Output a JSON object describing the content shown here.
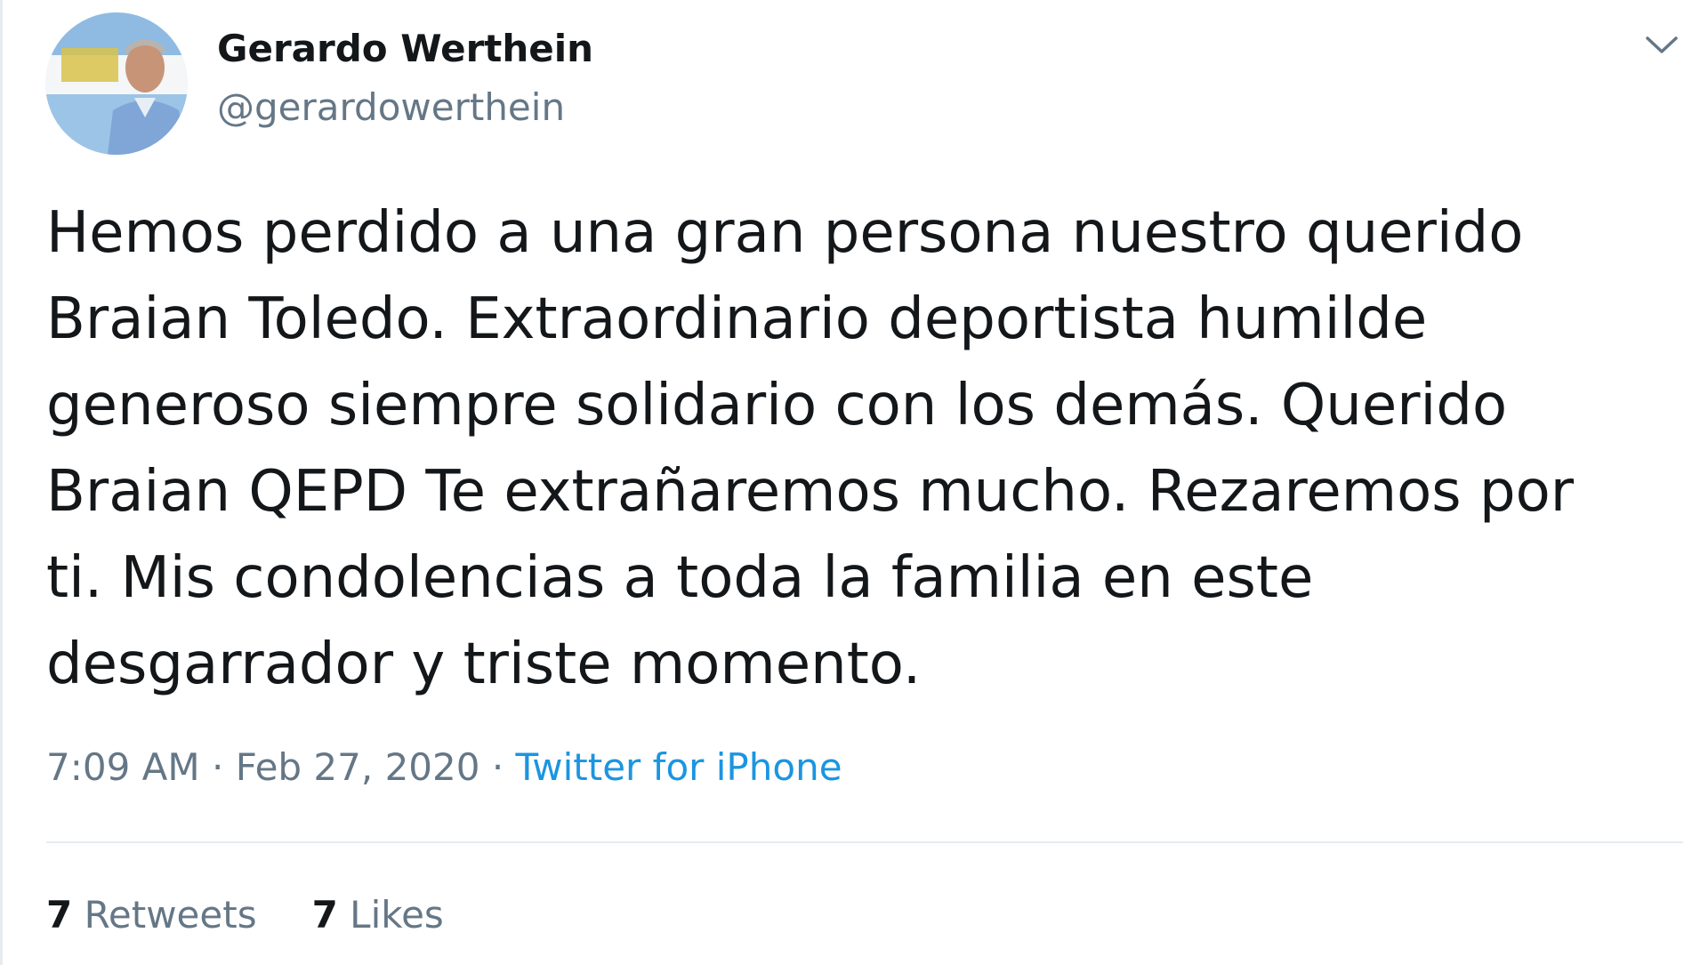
{
  "colors": {
    "text_primary": "#14171a",
    "text_secondary": "#657786",
    "link": "#1b95e0",
    "divider": "#e6ecf0"
  },
  "author": {
    "display_name": "Gerardo Werthein",
    "username": "@gerardowerthein",
    "avatar": "profile-photo"
  },
  "menu": {
    "icon": "chevron-down-icon"
  },
  "tweet": {
    "lines": [
      "Hemos perdido a una gran persona nuestro querido",
      "Braian Toledo. Extraordinario deportista humilde",
      "generoso siempre solidario con los demás.  Querido",
      "Braian QEPD   Te extrañaremos mucho. Rezaremos por",
      "ti.  Mis condolencias a toda la familia en este",
      "desgarrador y triste momento."
    ]
  },
  "meta": {
    "time": "7:09 AM",
    "separator": "·",
    "date": "Feb 27, 2020",
    "source": "Twitter for iPhone"
  },
  "stats": {
    "retweets_count": "7",
    "retweets_label": "Retweets",
    "likes_count": "7",
    "likes_label": "Likes"
  }
}
